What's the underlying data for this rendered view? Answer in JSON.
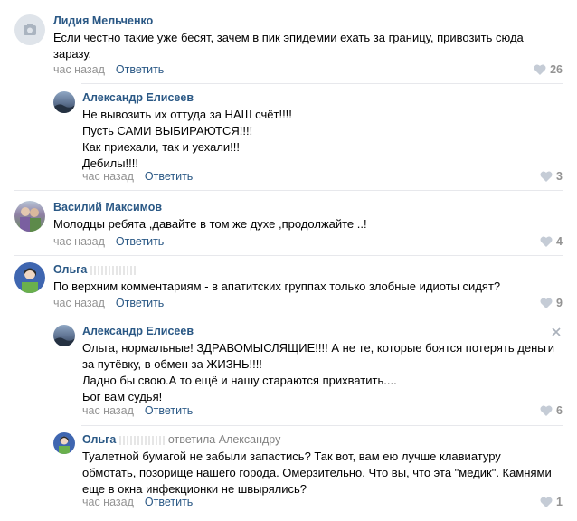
{
  "comments": [
    {
      "author": "Лидия Мельченко",
      "text": "Если честно такие уже бесят, зачем в пик эпидемии ехать за границу, привозить сюда\nзаразу.",
      "time": "час назад",
      "reply_label": "Ответить",
      "likes": "26"
    },
    {
      "author": "Александр Елисеев",
      "text": "Не вывозить их оттуда за НАШ счёт!!!!\nПусть САМИ ВЫБИРАЮТСЯ!!!!\nКак приехали, так и уехали!!!\nДебилы!!!!",
      "time": "час назад",
      "reply_label": "Ответить",
      "likes": "3"
    },
    {
      "author": "Василий Максимов",
      "text": "Молодцы ребята ,давайте в том же духе ,продолжайте ..!",
      "time": "час назад",
      "reply_label": "Ответить",
      "likes": "4"
    },
    {
      "author": "Ольга",
      "text": "По верхним комментариям - в апатитских группах только злобные идиоты сидят?",
      "time": "час назад",
      "reply_label": "Ответить",
      "likes": "9"
    },
    {
      "author": "Александр Елисеев",
      "text": "Ольга, нормальные! ЗДРАВОМЫСЛЯЩИЕ!!!! А не те, которые боятся потерять деньги\nза путёвку, в обмен за ЖИЗНЬ!!!!\nЛадно бы свою.А то ещё и нашу стараются прихватить....\nБог вам судья!",
      "time": "час назад",
      "reply_label": "Ответить",
      "likes": "6"
    },
    {
      "author": "Ольга",
      "reply_to": "ответила Александру",
      "text": "Туалетной бумагой не забыли запастись? Так вот, вам ею лучше клавиатуру\nобмотать, позорище нашего города. Омерзительно. Что вы, что эта \"медик\". Камнями\nеще в окна инфекционки не швырялись?",
      "time": "час назад",
      "reply_label": "Ответить",
      "likes": "1"
    }
  ],
  "colors": {
    "link": "#2a5885",
    "meta": "#939393",
    "separator": "#e7e8ec"
  }
}
